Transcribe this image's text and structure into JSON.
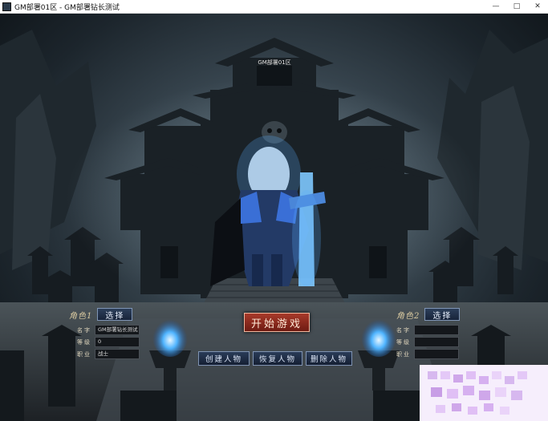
{
  "window": {
    "title": "GM部署01区 - GM部署钻长测试"
  },
  "scene": {
    "server_label": "GM部署01区"
  },
  "role1": {
    "label": "角色1",
    "select_label": "选择",
    "fields": [
      {
        "label": "名字",
        "value": "GM部署钻长测试"
      },
      {
        "label": "等级",
        "value": "0"
      },
      {
        "label": "职业",
        "value": "战士"
      }
    ]
  },
  "role2": {
    "label": "角色2",
    "select_label": "选择",
    "fields": [
      {
        "label": "名字",
        "value": ""
      },
      {
        "label": "等级",
        "value": ""
      },
      {
        "label": "职业",
        "value": ""
      }
    ]
  },
  "buttons": {
    "start": "开始游戏",
    "create": "创建人物",
    "restore": "恢复人物",
    "delete": "删除人物"
  },
  "colors": {
    "accent_red": "#8e2a1c",
    "button_blue": "#20304a",
    "flame_blue": "#3aa8ff"
  },
  "icons": {
    "minimize": "minimize-icon",
    "maximize": "maximize-icon",
    "close": "close-icon"
  }
}
